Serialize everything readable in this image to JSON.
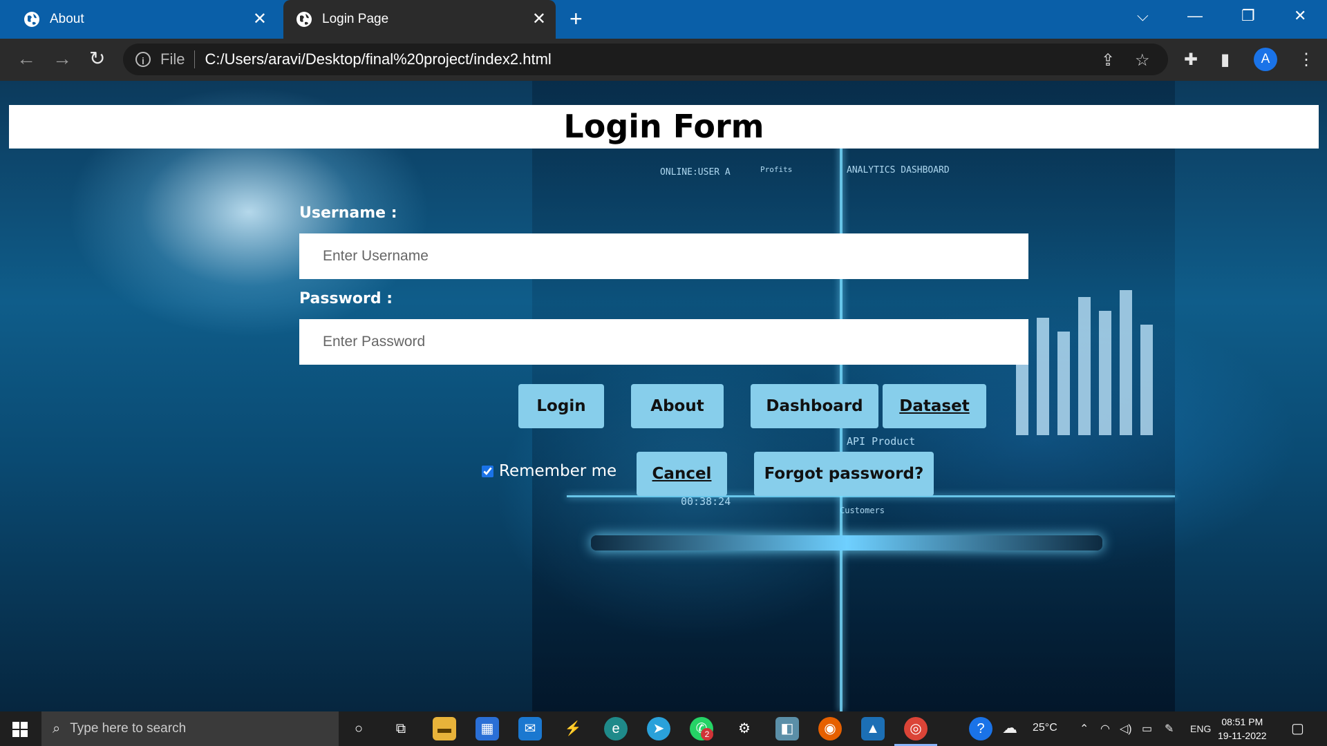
{
  "browser": {
    "tabs": [
      {
        "title": "About",
        "active": false
      },
      {
        "title": "Login Page",
        "active": true
      }
    ],
    "address": {
      "scheme_label": "File",
      "url": "C:/Users/aravi/Desktop/final%20project/index2.html"
    },
    "profile_initial": "A"
  },
  "page": {
    "title": "Login Form",
    "username_label": "Username :",
    "username_placeholder": "Enter Username",
    "password_label": "Password :",
    "password_placeholder": "Enter Password",
    "buttons": {
      "login": "Login",
      "about": "About",
      "dashboard": "Dashboard",
      "dataset": "Dataset",
      "cancel": "Cancel",
      "forgot": "Forgot password?"
    },
    "remember_label": "Remember me",
    "remember_checked": true,
    "background_text": {
      "online_user": "ONLINE:USER A",
      "profits": "Profits",
      "analytics": "ANALYTICS DASHBOARD",
      "timer": "00:38:24",
      "api_product": "API Product",
      "customers": "Customers"
    }
  },
  "taskbar": {
    "search_placeholder": "Type here to search",
    "notification_count": "2",
    "weather": "25°C",
    "language": "ENG",
    "time": "08:51 PM",
    "date": "19-11-2022"
  },
  "colors": {
    "tabstrip": "#0a5fa8",
    "toolbar": "#2b2b2b",
    "button": "#87ceeb",
    "taskbar": "#1f1f1f"
  }
}
